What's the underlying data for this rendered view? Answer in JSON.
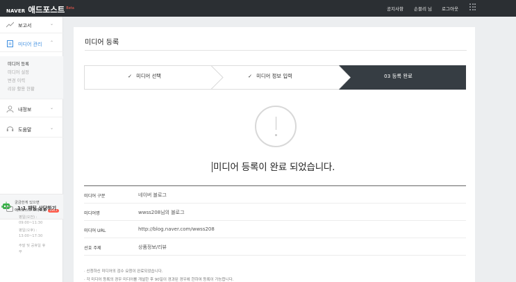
{
  "header": {
    "brand_naver": "NAVER",
    "brand_adpost": "애드포스트",
    "brand_beta": "Beta",
    "nav": [
      "공지사항",
      "손블리 님",
      "로그아웃"
    ]
  },
  "sidebar": {
    "menus": [
      {
        "label": "보고서",
        "icon": "chart-line-icon"
      },
      {
        "label": "미디어 관리",
        "icon": "document-icon"
      },
      {
        "label": "내정보",
        "icon": "person-icon"
      },
      {
        "label": "도움말",
        "icon": "headset-icon"
      }
    ],
    "submenu": [
      "미디어 등록",
      "미디어 설정",
      "변경 이력",
      "리뷰 활용 현황"
    ],
    "promo_line1": "궁금한게 있으면",
    "promo_line2": "애드포스트 스마트봇",
    "promo_badge": "Beta",
    "chat_title": "1:1 채팅 상담하기",
    "hours": [
      "평일(오전) :",
      "09:00~11:30",
      "평일(오후) :",
      "13:00~17:30",
      "주말 및 공휴일 휴",
      "무"
    ]
  },
  "main": {
    "title": "미디어 등록",
    "steps": [
      {
        "label": "미디어 선택",
        "done": true
      },
      {
        "label": "미디어 정보 입력",
        "done": true
      },
      {
        "label": "03  등록 완료",
        "current": true
      }
    ],
    "complete_message": "미디어 등록이 완료 되었습니다.",
    "info": [
      {
        "key": "미디어 구분",
        "value": "네이버 블로그"
      },
      {
        "key": "미디어명",
        "value": "wwss208님의 블로그"
      },
      {
        "key": "미디어 URL",
        "value": "http://blog.naver.com/wwss208"
      },
      {
        "key": "선호 주제",
        "value": "상품정보/리뷰"
      }
    ],
    "notes": [
      "· 신청하신 미디어의 검수 요청이 완료되었습니다.",
      "· 각 미디어 등록의 경우 미디어를 개설한 후 90일이 경과된 경우에 한하여 등록이 가능합니다."
    ]
  },
  "colors": {
    "topbar": "#2b2f33",
    "active_step": "#363d43",
    "accent": "#3b8de0"
  }
}
